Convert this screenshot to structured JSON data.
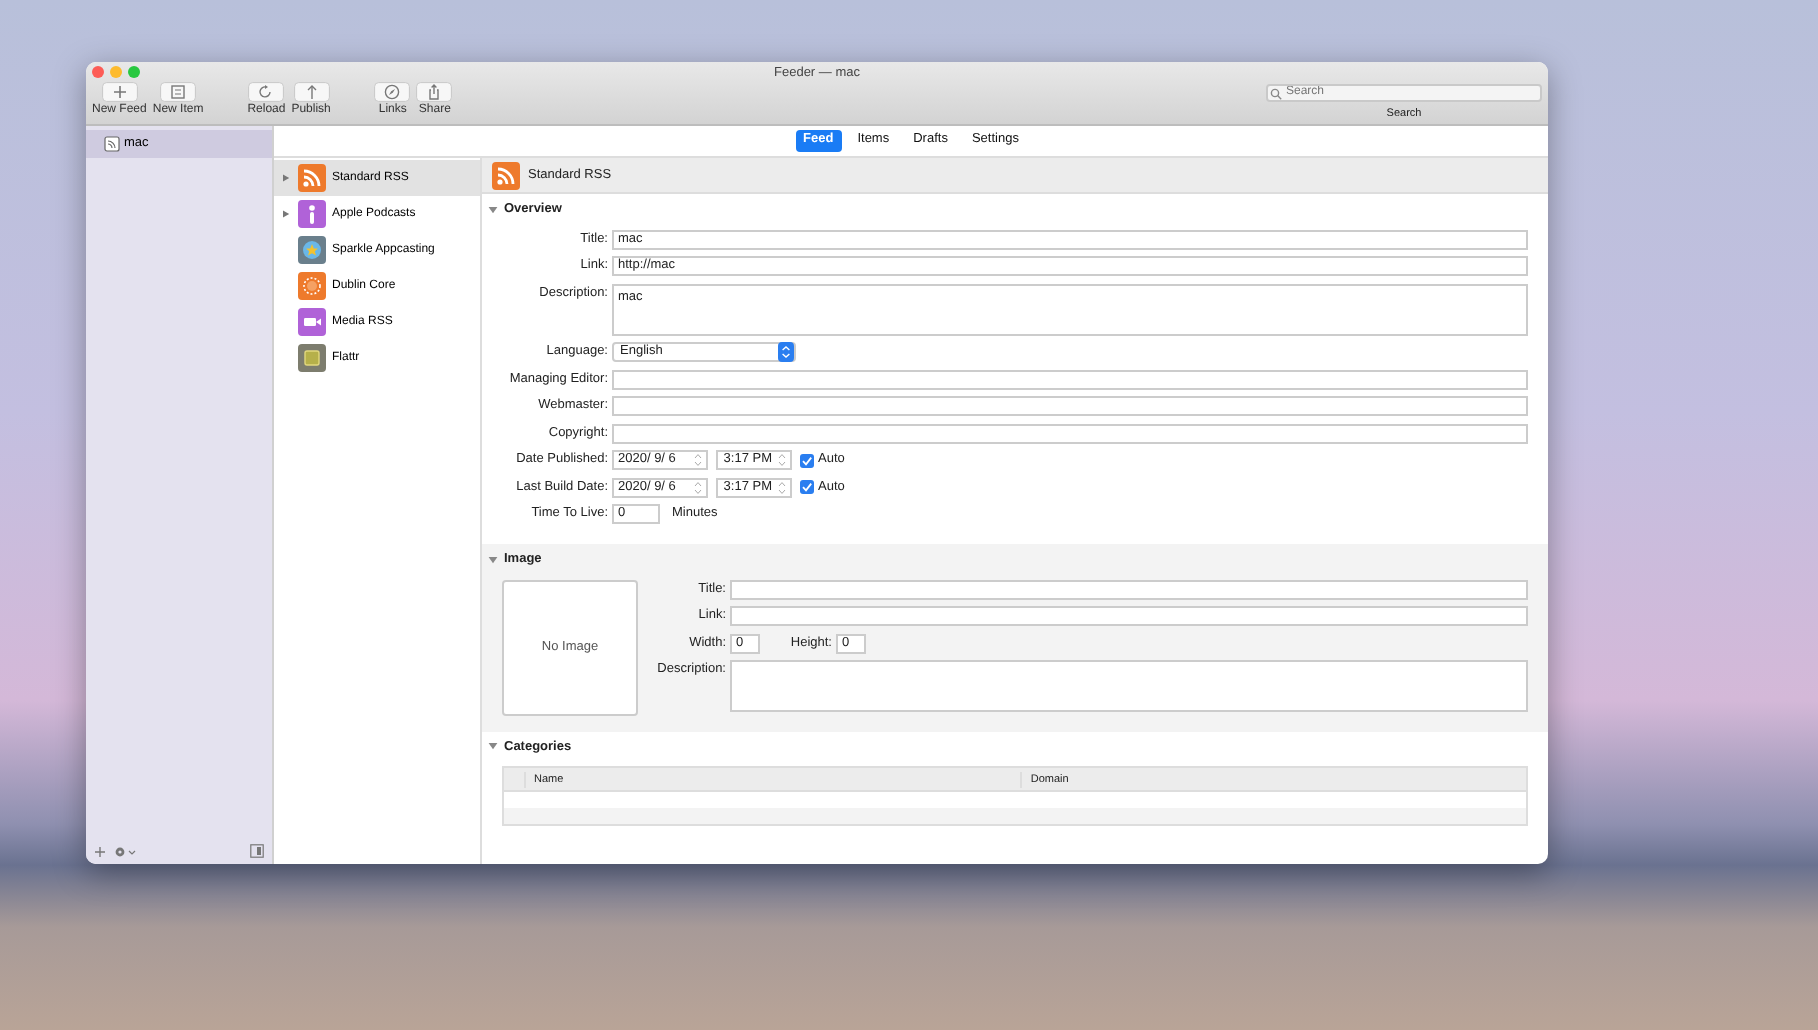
{
  "window": {
    "title": "Feeder — mac"
  },
  "toolbar": {
    "groups": [
      {
        "buttons": [
          {
            "kind": "plus",
            "label": "New Feed"
          },
          {
            "kind": "compose",
            "label": "New Item"
          }
        ]
      },
      {
        "buttons": [
          {
            "kind": "reload",
            "label": "Reload"
          },
          {
            "kind": "publish",
            "label": "Publish"
          }
        ]
      },
      {
        "buttons": [
          {
            "kind": "links",
            "label": "Links"
          },
          {
            "kind": "share",
            "label": "Share"
          }
        ]
      }
    ],
    "search": {
      "placeholder": "Search",
      "label": "Search"
    }
  },
  "sidebar": {
    "items": [
      {
        "label": "mac",
        "selected": true
      }
    ]
  },
  "tabs": [
    {
      "label": "Feed",
      "selected": true
    },
    {
      "label": "Items",
      "selected": false
    },
    {
      "label": "Drafts",
      "selected": false
    },
    {
      "label": "Settings",
      "selected": false
    }
  ],
  "formats": [
    {
      "kind": "rss",
      "label": "Standard RSS",
      "color": "#ee7a2c",
      "expandable": true,
      "selected": true
    },
    {
      "kind": "podcast",
      "label": "Apple Podcasts",
      "color": "#b062d8",
      "expandable": true,
      "selected": false
    },
    {
      "kind": "star",
      "label": "Sparkle Appcasting",
      "color": "#6a7f8c",
      "expandable": false,
      "selected": false
    },
    {
      "kind": "sun",
      "label": "Dublin Core",
      "color": "#ee7a2c",
      "expandable": false,
      "selected": false
    },
    {
      "kind": "camera",
      "label": "Media RSS",
      "color": "#b062d8",
      "expandable": false,
      "selected": false
    },
    {
      "kind": "square",
      "label": "Flattr",
      "color": "#7d7d6e",
      "expandable": false,
      "selected": false
    }
  ],
  "detail": {
    "header": "Standard RSS",
    "overview": {
      "title": "Overview",
      "expanded": true,
      "fields": [
        {
          "kind": "text",
          "label": "Title:",
          "value": "mac"
        },
        {
          "kind": "text",
          "label": "Link:",
          "value": "http://mac"
        },
        {
          "kind": "textarea",
          "label": "Description:",
          "value": "mac"
        },
        {
          "kind": "select",
          "label": "Language:",
          "value": "English"
        },
        {
          "kind": "text",
          "label": "Managing Editor:"
        },
        {
          "kind": "text",
          "label": "Webmaster:"
        },
        {
          "kind": "text",
          "label": "Copyright:"
        },
        {
          "kind": "date",
          "label": "Date Published:",
          "date": "2020/ 9/ 6",
          "time": "3:17 PM",
          "auto": {
            "label": "Auto",
            "checked": true
          }
        },
        {
          "kind": "date",
          "label": "Last Build Date:",
          "date": "2020/ 9/ 6",
          "time": "3:17 PM",
          "auto": {
            "label": "Auto",
            "checked": true
          }
        },
        {
          "kind": "number",
          "label": "Time To Live:",
          "value": "0",
          "unit": "Minutes"
        }
      ]
    },
    "image": {
      "title": "Image",
      "expanded": true,
      "placeholder_text": "No Image",
      "fields": [
        {
          "kind": "text",
          "label": "Title:"
        },
        {
          "kind": "text",
          "label": "Link:"
        },
        {
          "kind": "size",
          "label": "Width:",
          "value": "0",
          "label_2": "Height:",
          "value_2": "0"
        },
        {
          "kind": "textarea",
          "label": "Description:"
        }
      ]
    },
    "categories": {
      "title": "Categories",
      "expanded": true,
      "columns": [
        "Name",
        "Domain"
      ]
    }
  }
}
